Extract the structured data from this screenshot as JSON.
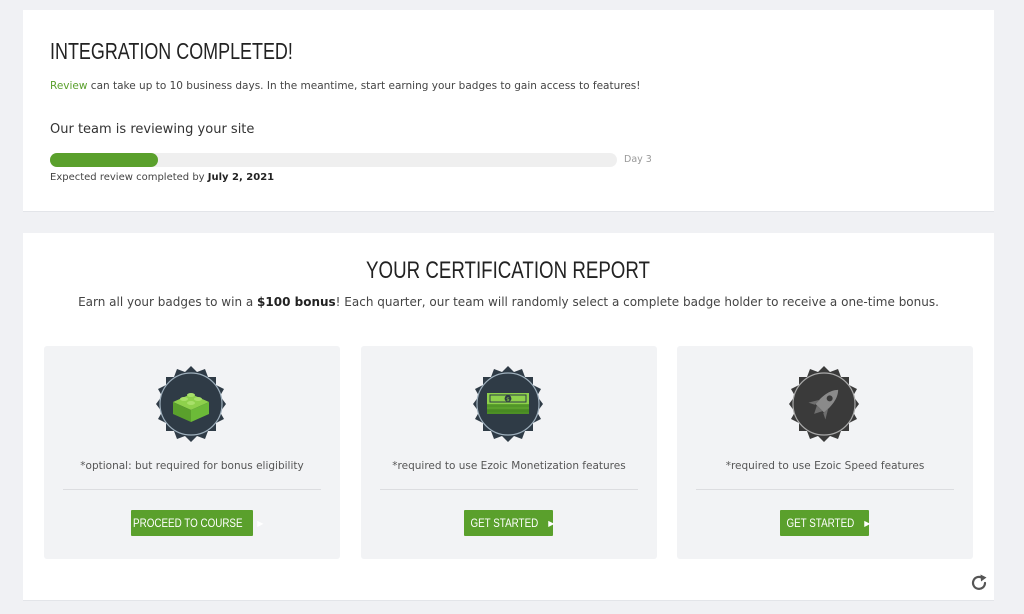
{
  "integration": {
    "title": "INTEGRATION COMPLETED!",
    "review_link": "Review",
    "review_note_rest": " can take up to 10 business days. In the meantime, start earning your badges to gain access to features!",
    "team_status": "Our team is reviewing your site",
    "progress_fraction": 0.19,
    "day_label": "Day 3",
    "expected_prefix": "Expected review completed by ",
    "expected_date": "July 2, 2021"
  },
  "report": {
    "title": "YOUR CERTIFICATION REPORT",
    "subtitle_pre": "Earn all your badges to win a ",
    "subtitle_bold": "$100 bonus",
    "subtitle_post": "! Each quarter, our team will randomly select a complete badge holder to receive a one-time bonus.",
    "badges": [
      {
        "icon": "lego-brick-icon",
        "note": "*optional: but required for bonus eligibility",
        "button": "PROCEED TO COURSE"
      },
      {
        "icon": "money-stack-icon",
        "note": "*required to use Ezoic Monetization features",
        "button": "GET STARTED"
      },
      {
        "icon": "rocket-icon",
        "note": "*required to use Ezoic Speed features",
        "button": "GET STARTED"
      }
    ]
  },
  "colors": {
    "accent_green": "#5aa02c",
    "badge_dark": "#2f3b46",
    "page_bg": "#f0f1f4"
  },
  "icons": {
    "refresh": "refresh-icon"
  }
}
